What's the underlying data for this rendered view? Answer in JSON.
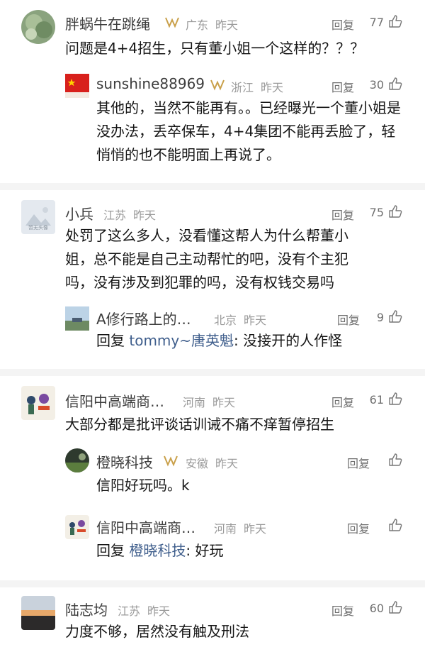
{
  "comments": [
    {
      "name": "胖蜗牛在跳绳",
      "location": "广东",
      "time": "昨天",
      "reply_label": "回复",
      "likes": "77",
      "text": "问题是4+4招生，只有董小姐一个这样的？？？",
      "replies": [
        {
          "name": "sunshine88969",
          "location": "浙江",
          "time": "昨天",
          "reply_label": "回复",
          "likes": "30",
          "text": "其他的，当然不能再有。。已经曝光一个董小姐是没办法，丢卒保车，4+4集团不能再丢脸了，轻悄悄的也不能明面上再说了。"
        }
      ]
    },
    {
      "name": "小兵",
      "location": "江苏",
      "time": "昨天",
      "reply_label": "回复",
      "likes": "75",
      "avatar_text": "暂无头像",
      "text": "处罚了这么多人，没看懂这帮人为什么帮董小姐，总不能是自己主动帮忙的吧，没有个主犯吗，没有涉及到犯罪的吗，没有权钱交易吗",
      "replies": [
        {
          "name": "A修行路上的…",
          "location": "北京",
          "time": "昨天",
          "reply_label": "回复",
          "likes": "9",
          "text_prefix": "回复 ",
          "text_target": "tommy~唐英魁",
          "text_body": ": 没接开的人作怪"
        }
      ]
    },
    {
      "name": "信阳中高端商…",
      "location": "河南",
      "time": "昨天",
      "reply_label": "回复",
      "likes": "61",
      "text": "大部分都是批评谈话训诫不痛不痒暂停招生",
      "replies": [
        {
          "name": "橙晓科技",
          "location": "安徽",
          "time": "昨天",
          "reply_label": "回复",
          "text": "信阳好玩吗。k"
        },
        {
          "name": "信阳中高端商…",
          "location": "河南",
          "time": "昨天",
          "reply_label": "回复",
          "text_prefix": "回复 ",
          "text_target": "橙晓科技",
          "text_body": ": 好玩"
        }
      ]
    },
    {
      "name": "陆志均",
      "location": "江苏",
      "time": "昨天",
      "reply_label": "回复",
      "likes": "60",
      "text": "力度不够，居然没有触及刑法"
    }
  ]
}
